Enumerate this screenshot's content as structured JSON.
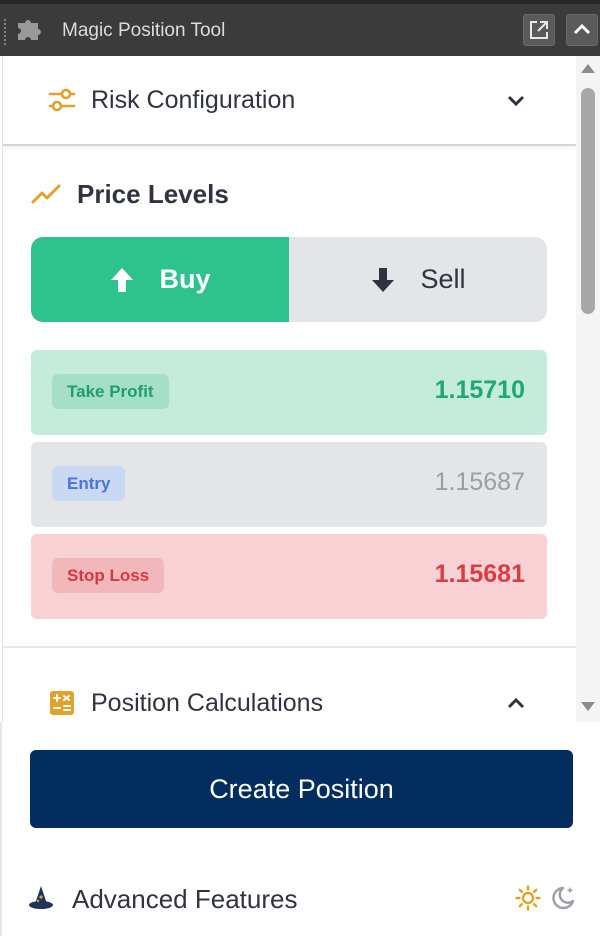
{
  "window": {
    "title": "Magic Position Tool",
    "popout_icon": "external-link-icon",
    "collapse_icon": "chevron-up-icon"
  },
  "risk_section": {
    "title": "Risk Configuration",
    "icon": "sliders-icon",
    "expanded": false
  },
  "price_levels": {
    "title": "Price Levels",
    "icon": "trend-line-icon",
    "direction": {
      "buy_label": "Buy",
      "sell_label": "Sell",
      "selected": "buy"
    },
    "levels": [
      {
        "label": "Take Profit",
        "value": "1.15710"
      },
      {
        "label": "Entry",
        "value": "1.15687"
      },
      {
        "label": "Stop Loss",
        "value": "1.15681"
      }
    ]
  },
  "calc_section": {
    "title": "Position Calculations",
    "icon": "calculator-icon",
    "expanded": true
  },
  "actions": {
    "create_label": "Create Position"
  },
  "advanced": {
    "title": "Advanced Features",
    "icon": "wizard-hat-icon",
    "theme_light_icon": "sun-icon",
    "theme_dark_icon": "moon-icon"
  },
  "colors": {
    "buy": "#2ec28d",
    "primary": "#032c5f",
    "accent": "#e0a22a",
    "take_profit": "#1fa874",
    "entry": "#4676dc",
    "stop_loss": "#db3c44"
  }
}
